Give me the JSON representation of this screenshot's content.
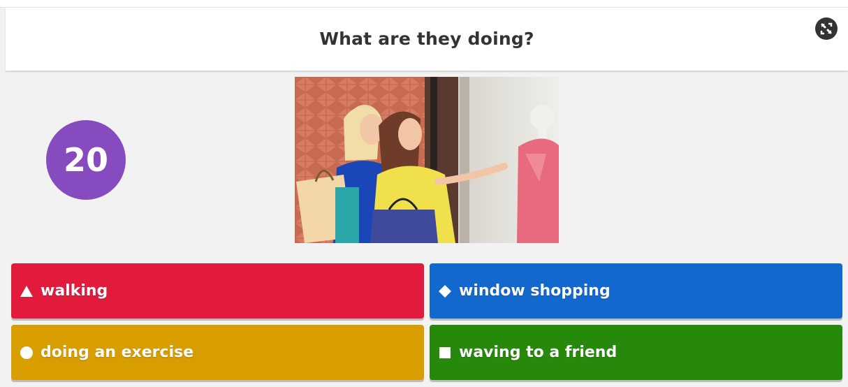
{
  "question": {
    "text": "What are they doing?"
  },
  "timer": {
    "value": "20",
    "color": "#864cbf"
  },
  "controls": {
    "fullscreen_icon": "fullscreen-icon"
  },
  "image": {
    "alt": "Two women with shopping bags looking at a dress in a shop window"
  },
  "answers": [
    {
      "label": "walking",
      "shape": "triangle-icon",
      "color": "#e21b3c"
    },
    {
      "label": "window shopping",
      "shape": "diamond-icon",
      "color": "#1368ce"
    },
    {
      "label": "doing an exercise",
      "shape": "circle-icon",
      "color": "#d89e00"
    },
    {
      "label": "waving to a friend",
      "shape": "square-icon",
      "color": "#26890c"
    }
  ]
}
